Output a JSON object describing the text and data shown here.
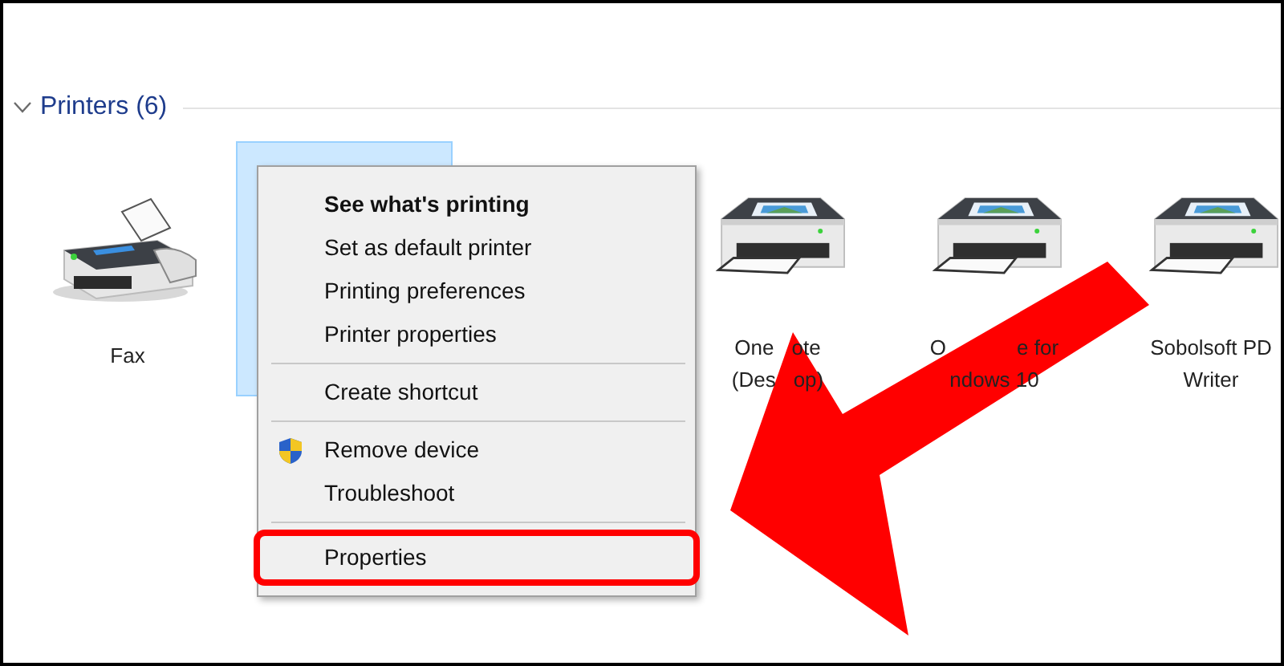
{
  "section": {
    "title": "Printers (6)",
    "expanded": true
  },
  "devices": [
    {
      "kind": "fax",
      "lines": [
        [
          "Fax"
        ]
      ],
      "selected": false
    },
    {
      "kind": "printer",
      "selected": true
    },
    {
      "kind": "printer",
      "lines": [
        [
          "One",
          "ote"
        ],
        [
          "(Des",
          "op)"
        ]
      ],
      "selected": false
    },
    {
      "kind": "printer",
      "lines": [
        [
          "O",
          "e for"
        ],
        [
          "ndows 10"
        ]
      ],
      "selected": false
    },
    {
      "kind": "printer",
      "lines": [
        [
          "Sobolsoft PD"
        ],
        [
          "Writer"
        ]
      ],
      "selected": false
    }
  ],
  "context_menu": {
    "items": [
      {
        "kind": "item",
        "label": "See what's printing",
        "default": true,
        "elevated": false,
        "annotated": false
      },
      {
        "kind": "item",
        "label": "Set as default printer",
        "default": false,
        "elevated": false,
        "annotated": false
      },
      {
        "kind": "item",
        "label": "Printing preferences",
        "default": false,
        "elevated": false,
        "annotated": false
      },
      {
        "kind": "item",
        "label": "Printer properties",
        "default": false,
        "elevated": false,
        "annotated": false
      },
      {
        "kind": "separator"
      },
      {
        "kind": "item",
        "label": "Create shortcut",
        "default": false,
        "elevated": false,
        "annotated": false
      },
      {
        "kind": "separator"
      },
      {
        "kind": "item",
        "label": "Remove device",
        "default": false,
        "elevated": true,
        "annotated": false
      },
      {
        "kind": "item",
        "label": "Troubleshoot",
        "default": false,
        "elevated": false,
        "annotated": false
      },
      {
        "kind": "separator"
      },
      {
        "kind": "item",
        "label": "Properties",
        "default": false,
        "elevated": false,
        "annotated": true
      }
    ]
  }
}
